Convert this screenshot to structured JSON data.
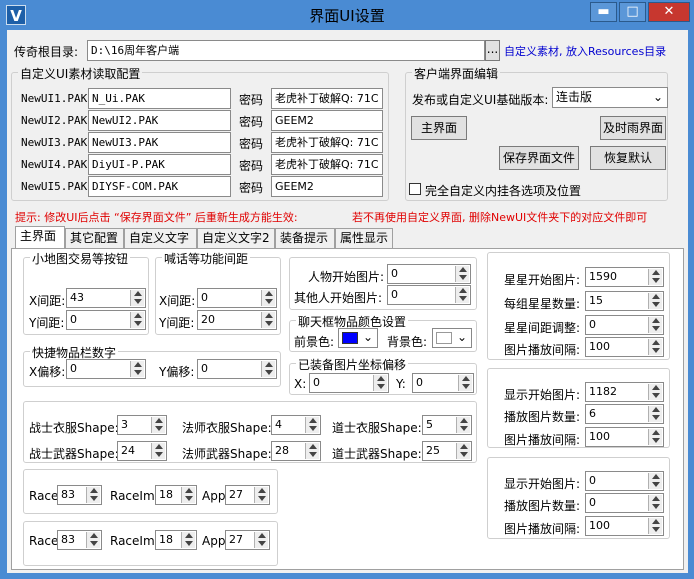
{
  "window": {
    "title": "界面UI设置",
    "app_icon_letter": "V",
    "min": "▬",
    "max": "□",
    "close": "✕"
  },
  "root": {
    "label": "传奇根目录:",
    "path": "D:\\16周年客户端",
    "browse": "...",
    "custom_link": "自定义素材, 放入Resources目录"
  },
  "read_group": {
    "title": "自定义UI素材读取配置",
    "pwd_label": "密码",
    "rows": [
      {
        "label": "NewUI1.PAK",
        "file": "N_Ui.PAK",
        "pwd": "老虎补丁破解Q: 71C"
      },
      {
        "label": "NewUI2.PAK",
        "file": "NewUI2.PAK",
        "pwd": "GEEM2"
      },
      {
        "label": "NewUI3.PAK",
        "file": "NewUI3.PAK",
        "pwd": "老虎补丁破解Q: 71C"
      },
      {
        "label": "NewUI4.PAK",
        "file": "DiyUI-P.PAK",
        "pwd": "老虎补丁破解Q: 71C"
      },
      {
        "label": "NewUI5.PAK",
        "file": "DIYSF-COM.PAK",
        "pwd": "GEEM2"
      }
    ]
  },
  "client_group": {
    "title": "客户端界面编辑",
    "version_label": "发布或自定义UI基础版本:",
    "version_value": "连击版",
    "main_btn": "主界面",
    "timely_btn": "及时雨界面",
    "save_btn": "保存界面文件",
    "restore_btn": "恢复默认",
    "checkbox_label": "完全自定义内挂各选项及位置"
  },
  "hint": {
    "left": "提示: 修改UI后点击 “保存界面文件” 后重新生成方能生效:",
    "right": "若不再使用自定义界面, 删除NewUI文件夹下的对应文件即可"
  },
  "tabs": [
    "主界面",
    "其它配置",
    "自定义文字",
    "自定义文字2",
    "装备提示",
    "属性显示"
  ],
  "minimap": {
    "title": "小地图交易等按钮",
    "x_label": "X间距:",
    "x": "43",
    "y_label": "Y间距:",
    "y": "0"
  },
  "shout": {
    "title": "喊话等功能间距",
    "x_label": "X间距:",
    "x": "0",
    "y_label": "Y间距:",
    "y": "20"
  },
  "quickbar": {
    "title": "快捷物品栏数字",
    "x_label": "X偏移:",
    "x": "0",
    "y_label": "Y偏移:",
    "y": "0"
  },
  "person": {
    "start_label": "人物开始图片:",
    "start": "0",
    "other_label": "其他人开始图片:",
    "other": "0"
  },
  "chat": {
    "title": "聊天框物品颜色设置",
    "fg_label": "前景色:",
    "fg_color": "#0000ff",
    "bg_label": "背景色:",
    "bg_color": "#ffffff"
  },
  "equip": {
    "title": "已装备图片坐标偏移",
    "x_label": "X:",
    "x": "0",
    "y_label": "Y:",
    "y": "0"
  },
  "shapes": [
    {
      "label": "战士衣服Shape:",
      "value": "3"
    },
    {
      "label": "法师衣服Shape:",
      "value": "4"
    },
    {
      "label": "道士衣服Shape:",
      "value": "5"
    },
    {
      "label": "战士武器Shape:",
      "value": "24"
    },
    {
      "label": "法师武器Shape:",
      "value": "28"
    },
    {
      "label": "道士武器Shape:",
      "value": "25"
    }
  ],
  "race1": {
    "race_label": "Race",
    "race": "83",
    "img_label": "RaceImg",
    "img": "18",
    "appr_label": "Appr",
    "appr": "27"
  },
  "race2": {
    "race_label": "Race",
    "race": "83",
    "img_label": "RaceImg",
    "img": "18",
    "appr_label": "Appr",
    "appr": "27"
  },
  "star": {
    "start_label": "星星开始图片:",
    "start": "1590",
    "count_label": "每组星星数量:",
    "count": "15",
    "gap_label": "星星间距调整:",
    "gap": "0",
    "interval_label": "图片播放间隔:",
    "interval": "100"
  },
  "disp1": {
    "start_label": "显示开始图片:",
    "start": "1182",
    "count_label": "播放图片数量:",
    "count": "6",
    "interval_label": "图片播放间隔:",
    "interval": "100"
  },
  "disp2": {
    "start_label": "显示开始图片:",
    "start": "0",
    "count_label": "播放图片数量:",
    "count": "0",
    "interval_label": "图片播放间隔:",
    "interval": "100"
  }
}
